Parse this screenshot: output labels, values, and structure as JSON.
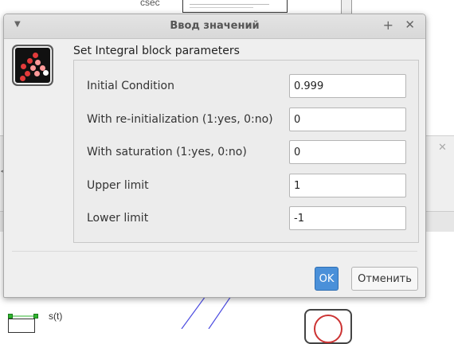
{
  "background": {
    "top_text": "csec",
    "signal_label": "s(t)"
  },
  "dialog": {
    "title": "Ввод значений",
    "subtitle": "Set Integral block parameters",
    "fields": [
      {
        "label": "Initial Condition",
        "value": "0.999"
      },
      {
        "label": "With re-initialization (1:yes, 0:no)",
        "value": "0"
      },
      {
        "label": "With saturation (1:yes, 0:no)",
        "value": "0"
      },
      {
        "label": "Upper limit",
        "value": "1"
      },
      {
        "label": "Lower limit",
        "value": "-1"
      }
    ],
    "buttons": {
      "ok": "OK",
      "cancel": "Отменить"
    },
    "icons": {
      "menu": "window-menu-icon",
      "pin": "pin-icon",
      "close": "close-icon",
      "app": "scilab-block-icon"
    },
    "colors": {
      "ok_button": "#4a90d9",
      "app_icon_bg": "#111111",
      "app_icon_dots": [
        "#e23b3b",
        "#ff9a9a",
        "#ffffff"
      ]
    }
  }
}
